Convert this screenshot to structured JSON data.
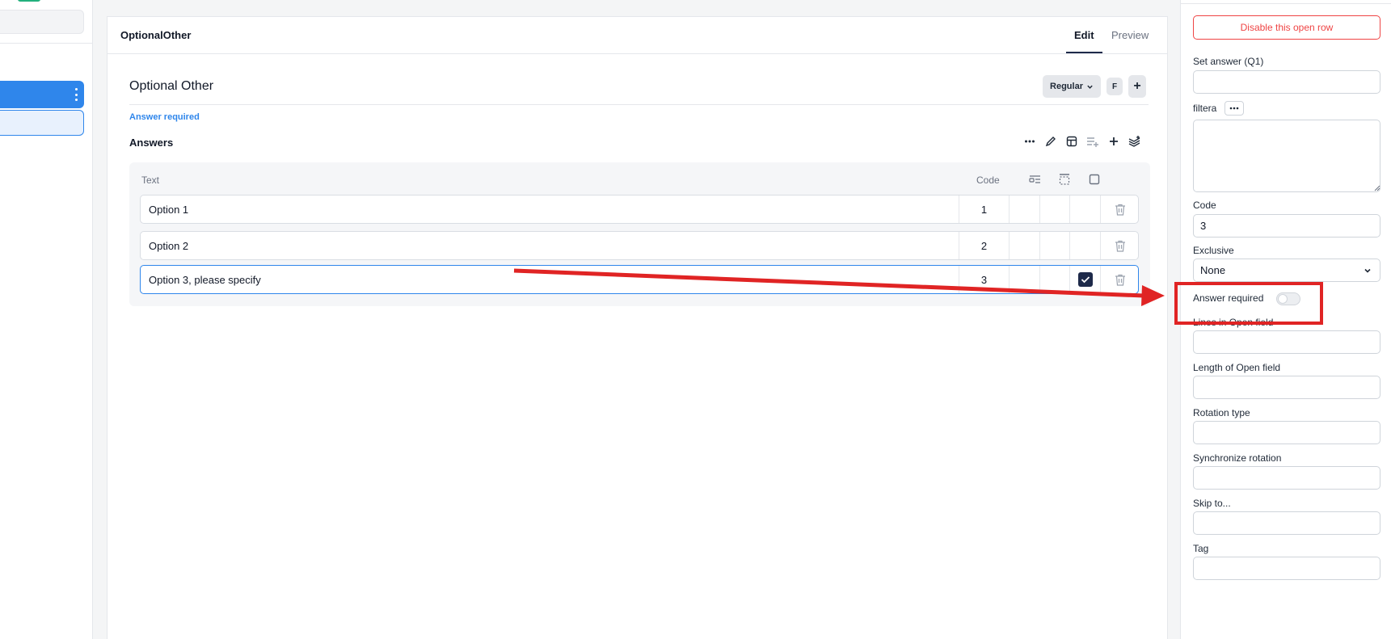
{
  "card": {
    "title": "OptionalOther",
    "tabs": {
      "edit": "Edit",
      "preview": "Preview"
    }
  },
  "question": {
    "title": "Optional Other",
    "type_select": "Regular",
    "f_badge": "F",
    "add_symbol": "+",
    "answer_required_link": "Answer required"
  },
  "answers": {
    "label": "Answers",
    "columns": {
      "text": "Text",
      "code": "Code"
    },
    "rows": [
      {
        "text": "Option 1",
        "code": "1",
        "open_checked": false
      },
      {
        "text": "Option 2",
        "code": "2",
        "open_checked": false
      },
      {
        "text": "Option 3, please specify",
        "code": "3",
        "open_checked": true
      }
    ]
  },
  "right_panel": {
    "disable_button": "Disable this open row",
    "set_answer_label": "Set answer (Q1)",
    "set_answer_value": "",
    "filter_label": "filtera",
    "filter_value": "",
    "code_label": "Code",
    "code_value": "3",
    "exclusive_label": "Exclusive",
    "exclusive_value": "None",
    "answer_required_label": "Answer required",
    "answer_required_on": false,
    "lines_label": "Lines in Open field",
    "lines_value": "",
    "length_label": "Length of Open field",
    "length_value": "",
    "rotation_label": "Rotation type",
    "rotation_value": "",
    "sync_label": "Synchronize rotation",
    "sync_value": "",
    "skip_label": "Skip to...",
    "skip_value": "",
    "tag_label": "Tag",
    "tag_value": ""
  },
  "colors": {
    "accent": "#2f86eb",
    "navy": "#1e2a4a",
    "danger": "#ef4444",
    "annotation": "#e02424"
  }
}
